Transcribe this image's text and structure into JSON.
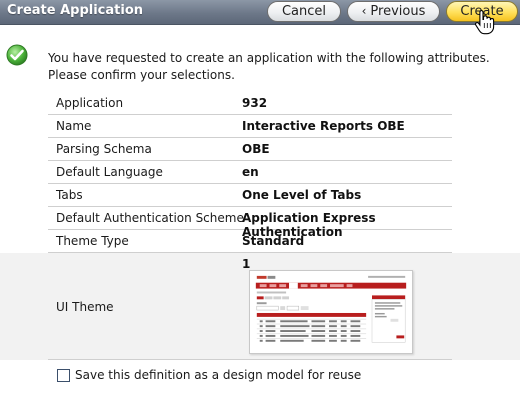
{
  "header": {
    "title": "Create Application",
    "cancel_label": "Cancel",
    "previous_label": "Previous",
    "create_label": "Create"
  },
  "intro_text": "You have requested to create an application with the following attributes. Please confirm your selections.",
  "attributes": [
    {
      "label": "Application",
      "value": "932"
    },
    {
      "label": "Name",
      "value": "Interactive Reports OBE"
    },
    {
      "label": "Parsing Schema",
      "value": "OBE"
    },
    {
      "label": "Default Language",
      "value": "en"
    },
    {
      "label": "Tabs",
      "value": "One Level of Tabs"
    },
    {
      "label": "Default Authentication Scheme",
      "value": "Application Express Authentication"
    },
    {
      "label": "Theme Type",
      "value": "Standard"
    }
  ],
  "theme": {
    "label": "UI Theme",
    "number": "1"
  },
  "save_definition": {
    "label": "Save this definition as a design model for reuse",
    "checked": false
  },
  "colors": {
    "header_bg": "#6d7889",
    "create_button": "#ffe05a",
    "success_check": "#3a9a2c",
    "theme_accent": "#b81e1e"
  },
  "icons": {
    "success": "check-circle-icon",
    "previous": "chevron-left-icon",
    "cursor": "hand-pointer-icon"
  }
}
